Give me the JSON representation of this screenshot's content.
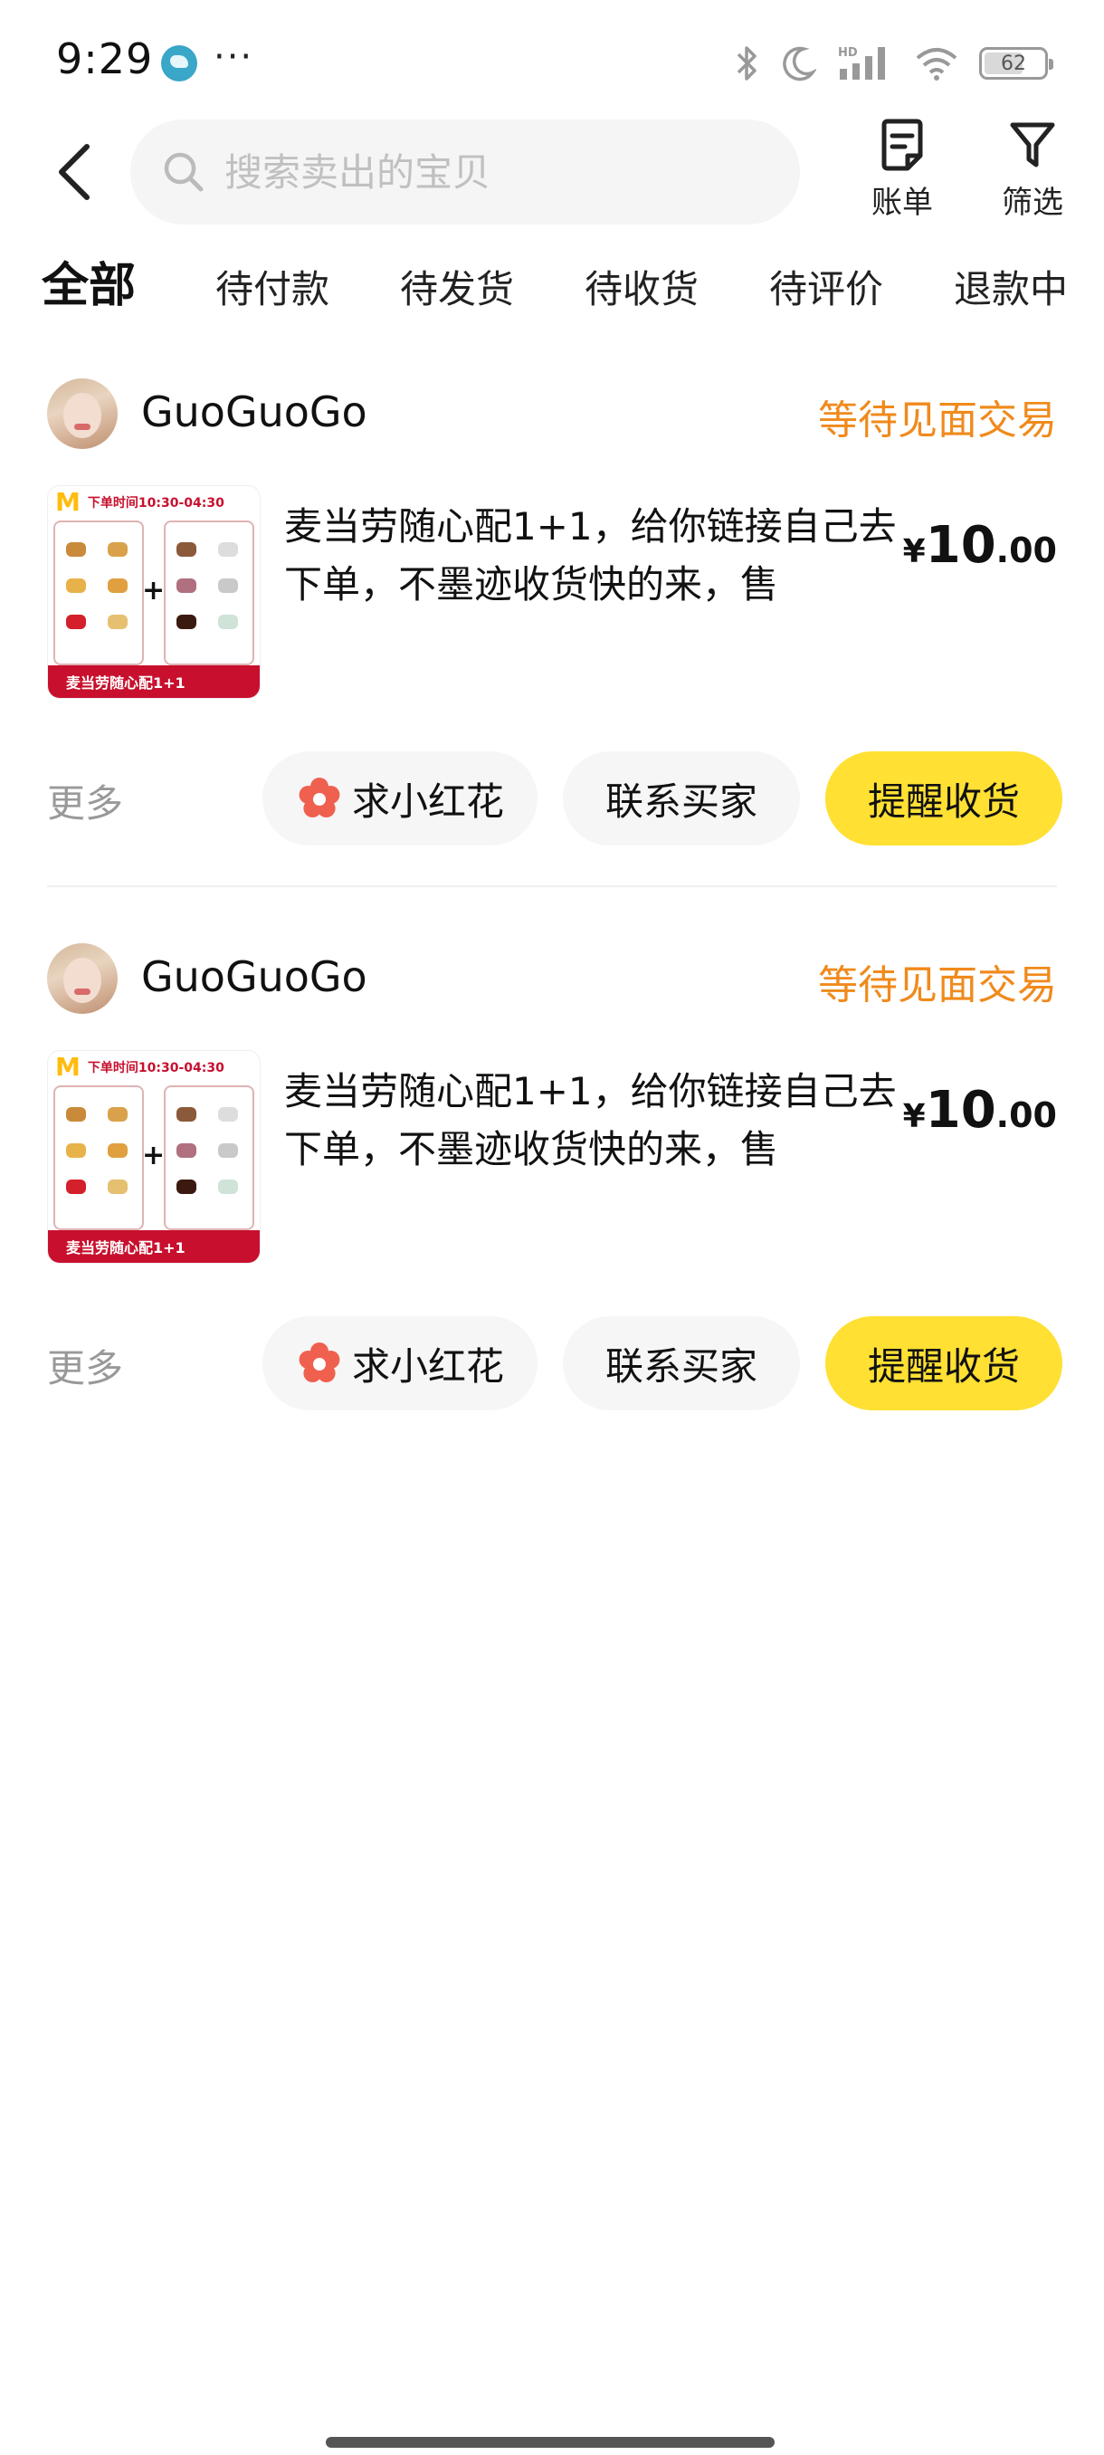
{
  "status_bar": {
    "time": "9:29",
    "more": "···",
    "battery": "62",
    "icons": [
      "app-notification-icon",
      "bluetooth-icon",
      "moon-icon",
      "signal-icon",
      "wifi-icon",
      "battery-icon"
    ]
  },
  "header": {
    "search_placeholder": "搜索卖出的宝贝",
    "bill_label": "账单",
    "filter_label": "筛选"
  },
  "tabs": [
    {
      "label": "全部",
      "active": true
    },
    {
      "label": "待付款"
    },
    {
      "label": "待发货"
    },
    {
      "label": "待收货"
    },
    {
      "label": "待评价"
    },
    {
      "label": "退款中"
    }
  ],
  "orders": [
    {
      "seller": "GuoGuoGo",
      "status": "等待见面交易",
      "title": "麦当劳随心配1+1，给你链接自己去下单，不墨迹收货快的来，售",
      "price_symbol": "¥",
      "price_int": "10",
      "price_dec": ".00",
      "thumb_time": "下单时间10:30-04:30",
      "thumb_band": "麦当劳随心配1+1",
      "more_label": "更多",
      "flower_label": "求小红花",
      "contact_label": "联系买家",
      "remind_label": "提醒收货"
    },
    {
      "seller": "GuoGuoGo",
      "status": "等待见面交易",
      "title": "麦当劳随心配1+1，给你链接自己去下单，不墨迹收货快的来，售",
      "price_symbol": "¥",
      "price_int": "10",
      "price_dec": ".00",
      "thumb_time": "下单时间10:30-04:30",
      "thumb_band": "麦当劳随心配1+1",
      "more_label": "更多",
      "flower_label": "求小红花",
      "contact_label": "联系买家",
      "remind_label": "提醒收货"
    }
  ],
  "colors": {
    "accent_yellow": "#ffe033",
    "status_orange": "#f08a1c",
    "flower_red": "#f0604f"
  }
}
